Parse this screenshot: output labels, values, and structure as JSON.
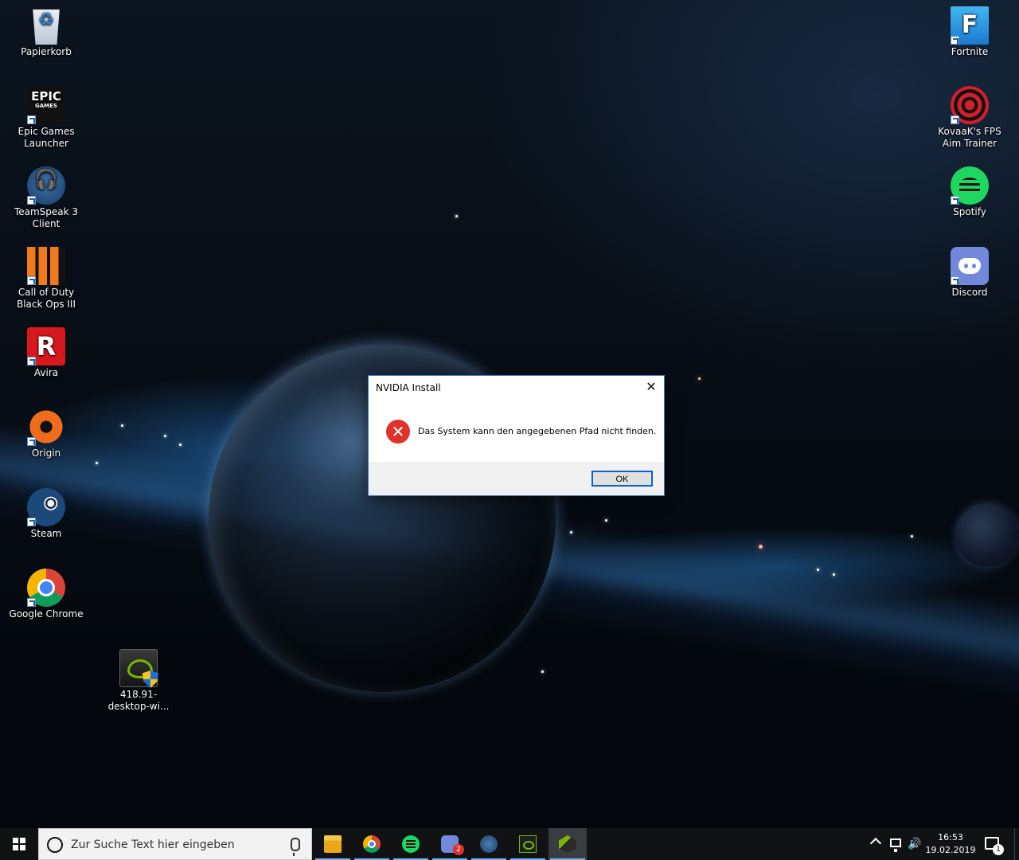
{
  "desktop": {
    "left_icons": [
      {
        "label": "Papierkorb",
        "icon": "recycle-bin-icon"
      },
      {
        "label": "Epic Games Launcher",
        "icon": "epic-games-icon",
        "glyph_text": "EPIC",
        "glyph_sub": "GAMES"
      },
      {
        "label": "TeamSpeak 3 Client",
        "icon": "teamspeak-icon"
      },
      {
        "label": "Call of Duty Black Ops III",
        "icon": "call-of-duty-icon"
      },
      {
        "label": "Avira",
        "icon": "avira-icon",
        "glyph_text": "R"
      },
      {
        "label": "Origin",
        "icon": "origin-icon"
      },
      {
        "label": "Steam",
        "icon": "steam-icon"
      },
      {
        "label": "Google Chrome",
        "icon": "chrome-icon"
      }
    ],
    "file_icon": {
      "label": "418.91-desktop-wi...",
      "icon": "nvidia-installer-icon"
    },
    "right_icons": [
      {
        "label": "Fortnite",
        "icon": "fortnite-icon",
        "glyph_text": "F"
      },
      {
        "label": "KovaaK's FPS Aim Trainer",
        "icon": "kovaak-icon"
      },
      {
        "label": "Spotify",
        "icon": "spotify-icon"
      },
      {
        "label": "Discord",
        "icon": "discord-icon"
      }
    ]
  },
  "dialog": {
    "title": "NVIDIA Install",
    "close_glyph": "✕",
    "error_glyph": "✕",
    "message": "Das System kann den angegebenen Pfad nicht finden.",
    "ok_label": "OK"
  },
  "taskbar": {
    "search_placeholder": "Zur Suche Text hier eingeben",
    "apps": [
      {
        "name": "file-explorer",
        "icon": "folder-icon"
      },
      {
        "name": "google-chrome",
        "icon": "chrome-icon"
      },
      {
        "name": "spotify",
        "icon": "spotify-icon"
      },
      {
        "name": "discord",
        "icon": "discord-icon",
        "badge": "2"
      },
      {
        "name": "teamspeak",
        "icon": "teamspeak-icon"
      },
      {
        "name": "nvidia",
        "icon": "nvidia-icon"
      },
      {
        "name": "nvidia-installer",
        "icon": "installer-icon"
      }
    ],
    "volume_glyph": "🔊",
    "time": "16:53",
    "date": "19.02.2019",
    "notification_count": "1"
  },
  "colors": {
    "accent": "#3b78c8",
    "error": "#e0322b",
    "taskbar": "#101214"
  }
}
